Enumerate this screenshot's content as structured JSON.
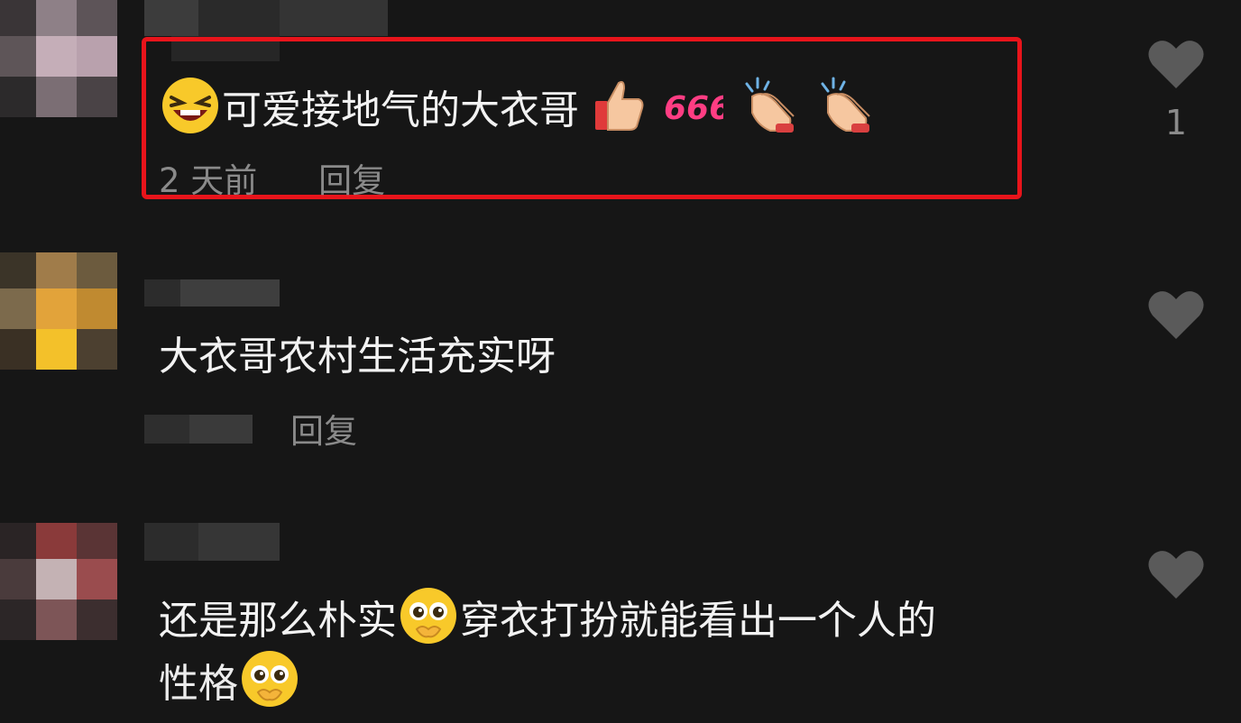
{
  "colors": {
    "background": "#161616",
    "highlight_border": "#e8141b",
    "muted_text": "#8a8a8a",
    "heart": "#5a5a5a"
  },
  "comments": [
    {
      "text": "可爱接地气的大衣哥",
      "emojis_before": [
        "laughing-face-emoji"
      ],
      "emojis_after": [
        "thumbs-up-emoji",
        "666-emoji",
        "clapping-hands-emoji",
        "clapping-hands-emoji"
      ],
      "emoji_666_label": "666",
      "time": "2 天前",
      "reply_label": "回复",
      "like_count": "1",
      "highlighted": true
    },
    {
      "text": "大衣哥农村生活充实呀",
      "reply_label": "回复",
      "like_count": ""
    },
    {
      "text_line1_a": "还是那么朴实",
      "text_line1_b": "穿衣打扮就能看出一个人的",
      "text_line2": "性格",
      "emojis": [
        "pleading-face-emoji",
        "pleading-face-emoji"
      ],
      "like_count": ""
    }
  ]
}
